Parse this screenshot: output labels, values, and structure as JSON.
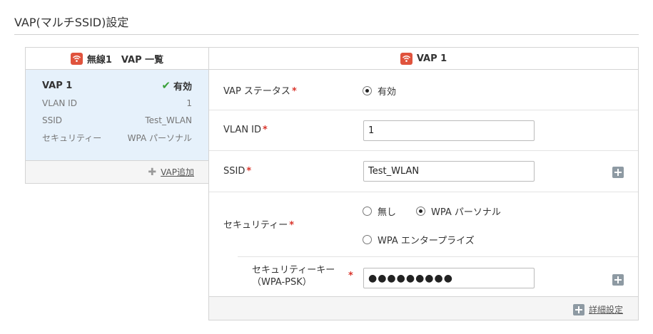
{
  "page": {
    "title": "VAP(マルチSSID)設定"
  },
  "left_panel": {
    "header": "無線1　VAP 一覧",
    "vap": {
      "name": "VAP 1",
      "status": "有効",
      "rows": [
        {
          "label": "VLAN ID",
          "value": "1"
        },
        {
          "label": "SSID",
          "value": "Test_WLAN"
        },
        {
          "label": "セキュリティー",
          "value": "WPA パーソナル"
        }
      ]
    },
    "add_vap_label": "VAP追加"
  },
  "right_panel": {
    "header": "VAP 1",
    "status": {
      "label": "VAP ステータス",
      "option": "有効"
    },
    "vlan": {
      "label": "VLAN ID",
      "value": "1"
    },
    "ssid": {
      "label": "SSID",
      "value": "Test_WLAN"
    },
    "security": {
      "label": "セキュリティー",
      "options": [
        "無し",
        "WPA パーソナル",
        "WPA エンタープライズ"
      ],
      "selected": "WPA パーソナル"
    },
    "security_key": {
      "label_line1": "セキュリティーキー",
      "label_line2": "（WPA-PSK）",
      "masked_value": "●●●●●●●●●"
    },
    "advanced_label": "詳細設定"
  },
  "required_mark": "*",
  "colors": {
    "accent": "#e0533d",
    "required": "#d9342b",
    "card_bg": "#e6f1fb",
    "check": "#3aa13a"
  },
  "icons": [
    "wifi-icon",
    "check-icon",
    "plus-icon",
    "plus-square-icon"
  ]
}
